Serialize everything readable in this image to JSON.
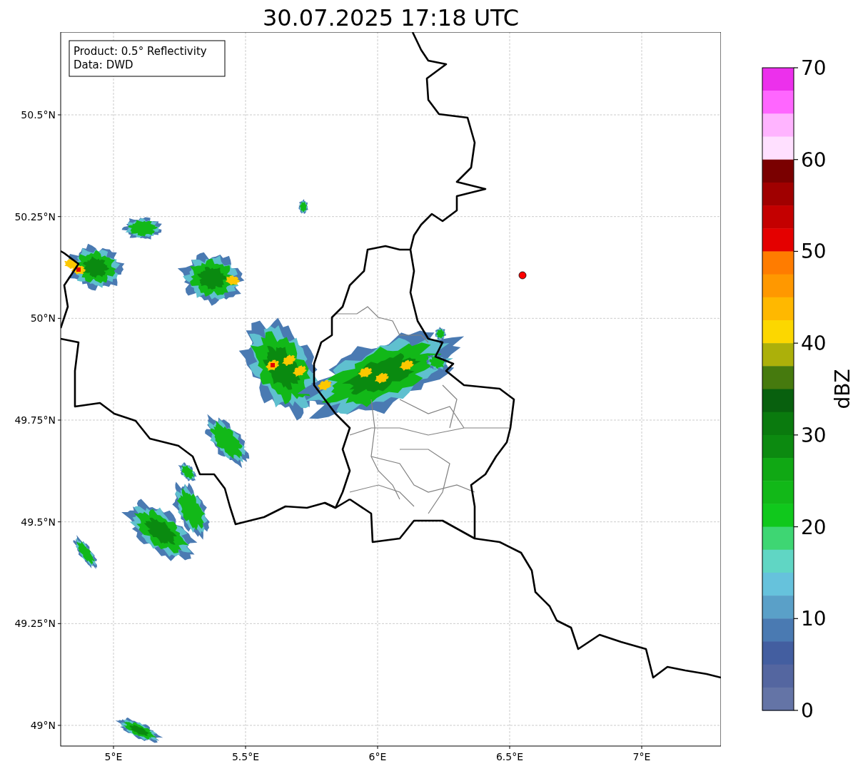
{
  "title": "30.07.2025 17:18 UTC",
  "info_box": [
    "Product: 0.5° Reflectivity",
    "Data: DWD"
  ],
  "lat_ticks": [
    "50.5°N",
    "50.25°N",
    "50°N",
    "49.75°N",
    "49.5°N",
    "49.25°N",
    "49°N"
  ],
  "lon_ticks": [
    "5°E",
    "5.5°E",
    "6°E",
    "6.5°E",
    "7°E"
  ],
  "colorbar": {
    "label": "dBZ",
    "ticks": [
      "70",
      "60",
      "50",
      "40",
      "30",
      "20",
      "10",
      "0"
    ],
    "bins": [
      {
        "color": "#ec30ec"
      },
      {
        "color": "#ff66ff"
      },
      {
        "color": "#ffb4ff"
      },
      {
        "color": "#ffe0ff"
      },
      {
        "color": "#7a0000"
      },
      {
        "color": "#a00000"
      },
      {
        "color": "#c40000"
      },
      {
        "color": "#e40000"
      },
      {
        "color": "#ff7c00"
      },
      {
        "color": "#ff9800"
      },
      {
        "color": "#ffb800"
      },
      {
        "color": "#fcd700"
      },
      {
        "color": "#acb00a"
      },
      {
        "color": "#467a0e"
      },
      {
        "color": "#08600e"
      },
      {
        "color": "#0a7a0e"
      },
      {
        "color": "#0c8a10"
      },
      {
        "color": "#10a814"
      },
      {
        "color": "#12b818"
      },
      {
        "color": "#10c81c"
      },
      {
        "color": "#3ed673"
      },
      {
        "color": "#60d6c4"
      },
      {
        "color": "#66c2dc"
      },
      {
        "color": "#5aa0c8"
      },
      {
        "color": "#4a7ab2"
      },
      {
        "color": "#435ea0"
      },
      {
        "color": "#5466a0"
      },
      {
        "color": "#6474a6"
      }
    ]
  }
}
